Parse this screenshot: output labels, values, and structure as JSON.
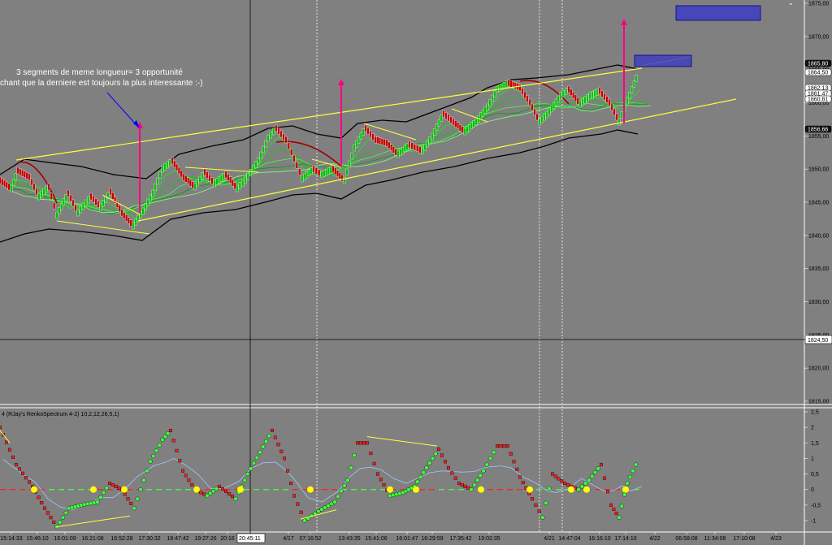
{
  "annotation": {
    "line1": "3 segments de meme longueur= 3 opportunité",
    "line2": "chant que la derniere est toujours la plus interessante :-)"
  },
  "indicator_title": "4 (RJay's RenkoSpectrum 4-2) 10,2,12,26,5,1)",
  "crosshair_time": "20:45:11",
  "crosshair_price": "1824,50",
  "colors": {
    "background": "#808080",
    "bull_brick": "#00c000",
    "bear_brick": "#c00000",
    "channel": "#ffff40",
    "band": "#000000",
    "arrow_up": "#ff0080",
    "arrow_blue": "#0000ff",
    "target_box": "#4040c0"
  },
  "price_tags": [
    {
      "label": "1865,80",
      "style": "dark"
    },
    {
      "label": "1864,50",
      "style": "light"
    },
    {
      "label": "1862,13",
      "style": "light"
    },
    {
      "label": "1861,47",
      "style": "light"
    },
    {
      "label": "1860,81",
      "style": "light"
    },
    {
      "label": "1856,66",
      "style": "dark"
    }
  ],
  "chart_data": {
    "type": "line",
    "ylim": [
      1814,
      1876
    ],
    "ytick_labels": [
      "1875,00",
      "1870,00",
      "1865,00",
      "1860,00",
      "1855,00",
      "1850,00",
      "1845,00",
      "1840,00",
      "1835,00",
      "1830,00",
      "1825,00",
      "1820,00",
      "1815,00"
    ],
    "xtick_labels": [
      "15:14:33",
      "15:46:10",
      "16:01:09",
      "16:21:08",
      "16:52:28",
      "17:30:32",
      "18:47:42",
      "19:27:26",
      "20:16",
      "4/17",
      "07:16:52",
      "13:43:35",
      "15:41:06",
      "16:01:47",
      "16:29:59",
      "17:35:42",
      "19:02:35",
      "4/21",
      "14:47:04",
      "16:16:10",
      "17:14:10",
      "4/22",
      "06:58:08",
      "11:34:08",
      "17:10:08",
      "4/23"
    ],
    "indicator": {
      "ylim": [
        -1.25,
        2.5
      ],
      "ytick_labels": [
        "2,5",
        "2",
        "1,5",
        "1",
        "0,5",
        "0",
        "-0,5",
        "-1"
      ]
    }
  }
}
